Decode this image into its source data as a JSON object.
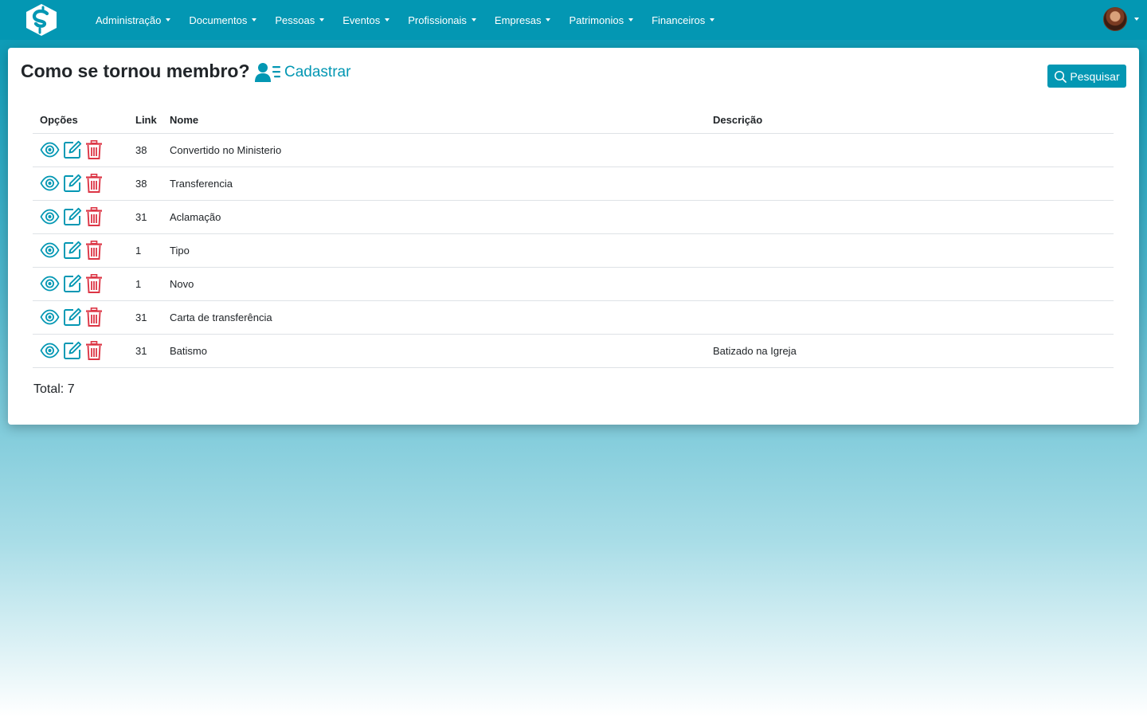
{
  "navbar": {
    "brand_icon": "s-logo-icon",
    "menu": [
      {
        "label": "Administração"
      },
      {
        "label": "Documentos"
      },
      {
        "label": "Pessoas"
      },
      {
        "label": "Eventos"
      },
      {
        "label": "Profissionais"
      },
      {
        "label": "Empresas"
      },
      {
        "label": "Patrimonios"
      },
      {
        "label": "Financeiros"
      }
    ],
    "user_icon": "avatar"
  },
  "page": {
    "title": "Como se tornou membro?",
    "create_label": "Cadastrar",
    "search_label": "Pesquisar"
  },
  "table": {
    "headers": {
      "options": "Opções",
      "link": "Link",
      "name": "Nome",
      "description": "Descrição"
    },
    "rows": [
      {
        "link": "38",
        "name": "Convertido no Ministerio",
        "description": ""
      },
      {
        "link": "38",
        "name": "Transferencia",
        "description": ""
      },
      {
        "link": "31",
        "name": "Aclamação",
        "description": ""
      },
      {
        "link": "1",
        "name": "Tipo",
        "description": ""
      },
      {
        "link": "1",
        "name": "Novo",
        "description": ""
      },
      {
        "link": "31",
        "name": "Carta de transferência",
        "description": ""
      },
      {
        "link": "31",
        "name": "Batismo",
        "description": "Batizado na Igreja"
      }
    ]
  },
  "footer": {
    "total": "Total: 7"
  },
  "colors": {
    "primary": "#0397b3",
    "danger": "#dc3545"
  }
}
